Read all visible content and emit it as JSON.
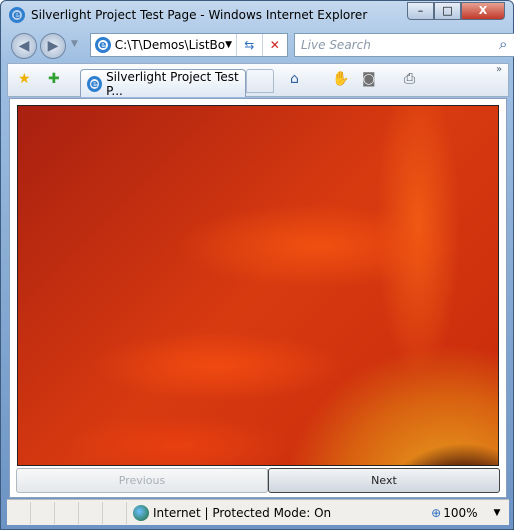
{
  "window": {
    "title": "Silverlight Project Test Page - Windows Internet Explorer",
    "min": "–",
    "max": "□",
    "close": "X"
  },
  "nav": {
    "back": "◀",
    "forward": "▶",
    "address": "C:\\T\\Demos\\ListBo",
    "refresh": "⇆",
    "stop": "✕",
    "search_placeholder": "Live Search",
    "search_icon": "⌕"
  },
  "toolbar": {
    "tab_title": "Silverlight Project Test P...",
    "favorites": "★",
    "add_favorites": "✚",
    "home": "⌂",
    "hand": "✋",
    "rss": "◙",
    "print": "⎙",
    "more": "»"
  },
  "page": {
    "previous": "Previous",
    "next": "Next"
  },
  "status": {
    "zone": "Internet | Protected Mode: On",
    "zoom": "100%"
  }
}
